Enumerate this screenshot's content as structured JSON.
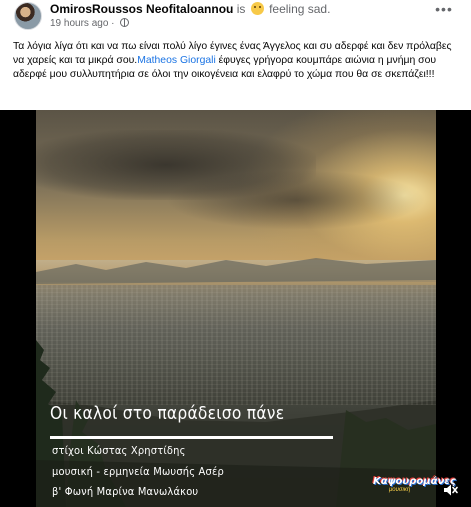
{
  "post": {
    "author": "OmirosRoussos Neofitaloannou",
    "feeling_prefix": "is",
    "feeling": "feeling sad.",
    "feeling_icon": "sad-face-icon",
    "timestamp": "19 hours ago",
    "separator": "·",
    "audience_icon": "globe-icon",
    "more_label": "•••",
    "text_before_mention": "Τα λόγια λίγα ότι και να πω είναι πολύ λίγο έγινες ένας Άγγελος και συ αδερφέ και δεν πρόλαβες να χαρείς και τα μικρά σου.",
    "mention": "Matheos Giorgali",
    "text_after_mention": " έφυγες γρήγορα κουμπάρε αιώνια η μνήμη σου αδερφέ μου συλλυπητήρια σε όλοι την οικογένεια και ελαφρύ το χώμα που θα σε σκεπάζει!!!"
  },
  "video": {
    "title": "Οι καλοί στο παράδεισο πάνε",
    "credit_lyrics": "στίχοι Κώστας Χρηστίδης",
    "credit_music": "μουσική - ερμηνεία Μωυσής Ασέρ",
    "credit_voice": "β' Φωνή Μαρίνα Μανωλάκου",
    "logo_main": "Καψουρομάνες",
    "logo_sub": "μουσική",
    "mute_icon": "volume-muted-icon"
  },
  "colors": {
    "link": "#1b74e4",
    "meta": "#65676b",
    "text": "#050505"
  }
}
